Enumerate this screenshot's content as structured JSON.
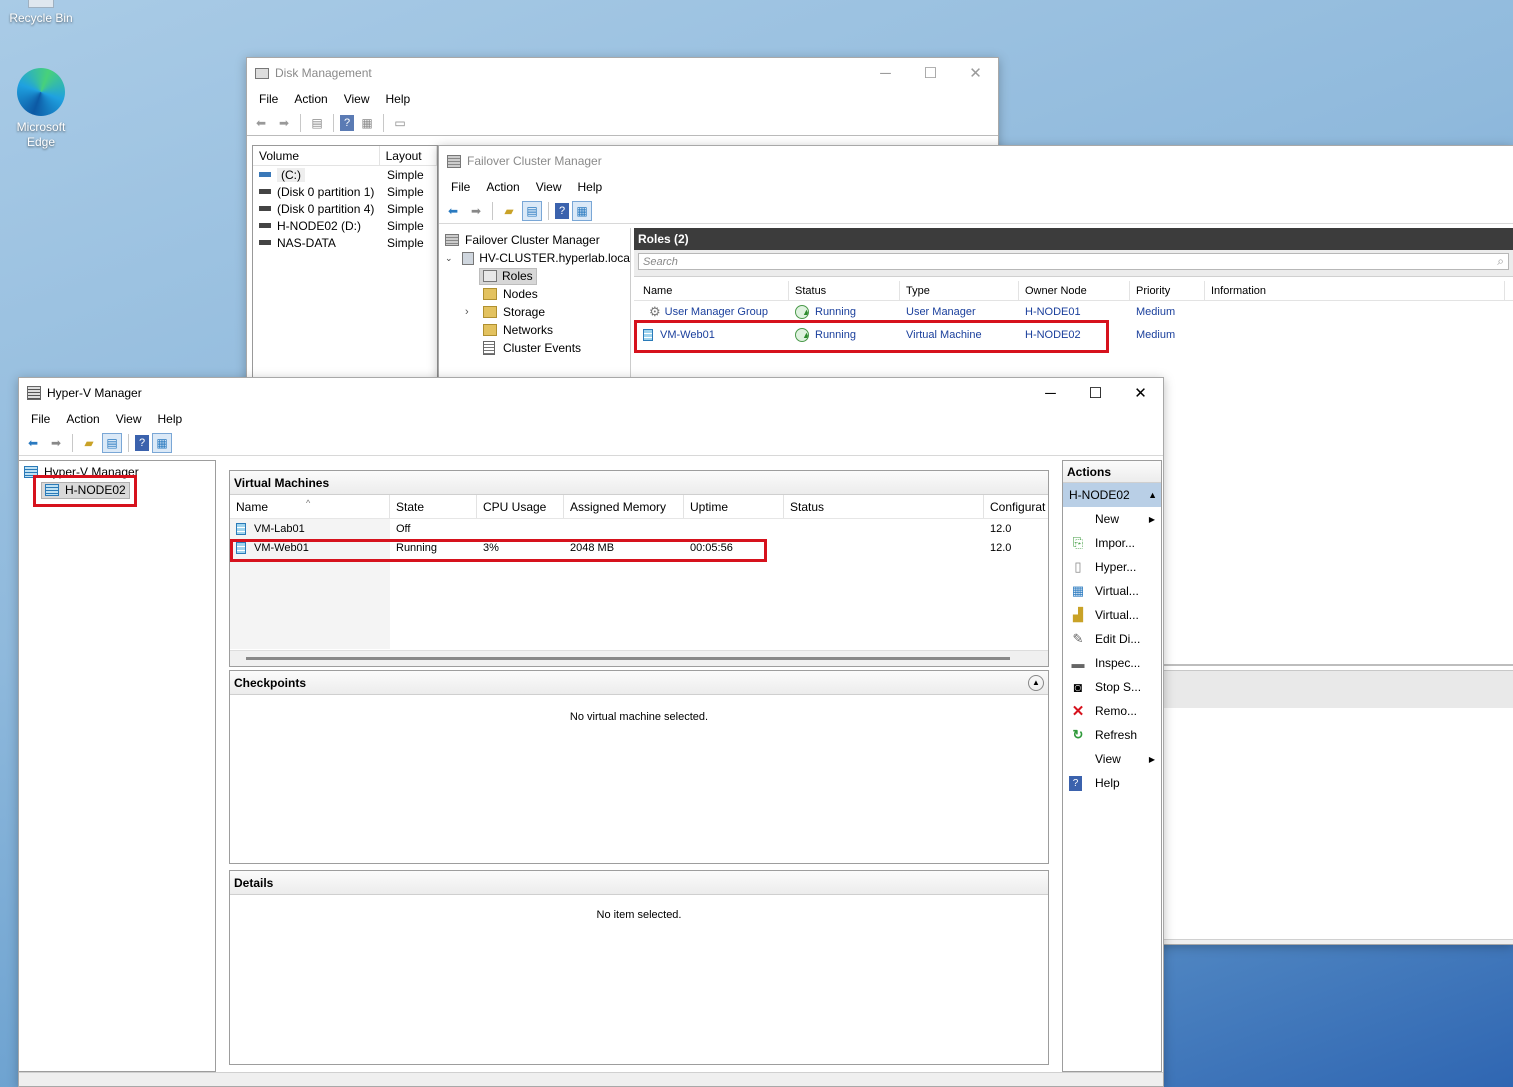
{
  "desktop": {
    "icons": [
      {
        "label": "Recycle Bin"
      },
      {
        "label": "Microsoft Edge"
      }
    ]
  },
  "disk_mgmt": {
    "title": "Disk Management",
    "menu": [
      "File",
      "Action",
      "View",
      "Help"
    ],
    "columns": [
      "Volume",
      "Layout"
    ],
    "rows": [
      {
        "volume": "(C:)",
        "layout": "Simple"
      },
      {
        "volume": "(Disk 0 partition 1)",
        "layout": "Simple"
      },
      {
        "volume": "(Disk 0 partition 4)",
        "layout": "Simple"
      },
      {
        "volume": "H-NODE02 (D:)",
        "layout": "Simple"
      },
      {
        "volume": "NAS-DATA",
        "layout": "Simple"
      }
    ]
  },
  "fcm": {
    "title": "Failover Cluster Manager",
    "menu": [
      "File",
      "Action",
      "View",
      "Help"
    ],
    "tree": {
      "root": "Failover Cluster Manager",
      "cluster": "HV-CLUSTER.hyperlab.loca",
      "items": [
        "Roles",
        "Nodes",
        "Storage",
        "Networks",
        "Cluster Events"
      ]
    },
    "roles_header": "Roles (2)",
    "search_placeholder": "Search",
    "columns": [
      "Name",
      "Status",
      "Type",
      "Owner Node",
      "Priority",
      "Information"
    ],
    "rows": [
      {
        "name": "User Manager Group",
        "status": "Running",
        "type": "User Manager",
        "owner": "H-NODE01",
        "priority": "Medium",
        "info": ""
      },
      {
        "name": "VM-Web01",
        "status": "Running",
        "type": "Virtual Machine",
        "owner": "H-NODE02",
        "priority": "Medium",
        "info": ""
      }
    ]
  },
  "hyperv": {
    "title": "Hyper-V Manager",
    "menu": [
      "File",
      "Action",
      "View",
      "Help"
    ],
    "tree": {
      "root": "Hyper-V Manager",
      "node": "H-NODE02"
    },
    "vm_pane_title": "Virtual Machines",
    "vm_columns": [
      "Name",
      "State",
      "CPU Usage",
      "Assigned Memory",
      "Uptime",
      "Status",
      "Configurat"
    ],
    "vms": [
      {
        "name": "VM-Lab01",
        "state": "Off",
        "cpu": "",
        "memory": "",
        "uptime": "",
        "status": "",
        "config": "12.0"
      },
      {
        "name": "VM-Web01",
        "state": "Running",
        "cpu": "3%",
        "memory": "2048 MB",
        "uptime": "00:05:56",
        "status": "",
        "config": "12.0"
      }
    ],
    "checkpoints_title": "Checkpoints",
    "checkpoints_empty": "No virtual machine selected.",
    "details_title": "Details",
    "details_empty": "No item selected.",
    "actions_title": "Actions",
    "actions_node": "H-NODE02",
    "actions": [
      {
        "label": "New",
        "icon": "none",
        "submenu": true
      },
      {
        "label": "Impor...",
        "icon": "import-icon"
      },
      {
        "label": "Hyper...",
        "icon": "settings-icon"
      },
      {
        "label": "Virtual...",
        "icon": "switch-manager-icon"
      },
      {
        "label": "Virtual...",
        "icon": "san-manager-icon"
      },
      {
        "label": "Edit Di...",
        "icon": "edit-disk-icon"
      },
      {
        "label": "Inspec...",
        "icon": "inspect-disk-icon"
      },
      {
        "label": "Stop S...",
        "icon": "stop-icon"
      },
      {
        "label": "Remo...",
        "icon": "remove-icon"
      },
      {
        "label": "Refresh",
        "icon": "refresh-icon"
      },
      {
        "label": "View",
        "icon": "none",
        "submenu": true
      },
      {
        "label": "Help",
        "icon": "help-icon"
      }
    ]
  },
  "colors": {
    "highlight": "#d6121d",
    "roles_header_bg": "#3c3c3c",
    "link_blue": "#1a3f9c",
    "action_selected_bg": "#b9cfe6"
  }
}
